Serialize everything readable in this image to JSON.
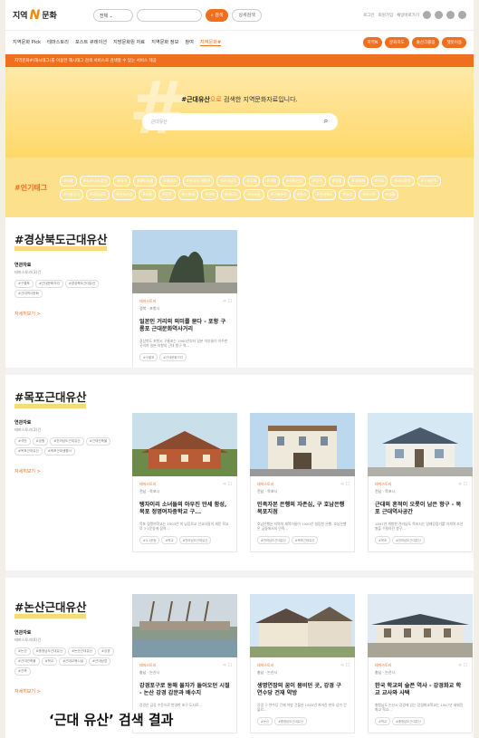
{
  "header": {
    "logo_left": "지역",
    "logo_mark": "N",
    "logo_right": "문화",
    "search_select": "전체",
    "search_button": "검색",
    "detail_search": "상세검색",
    "util_links": [
      "로그인",
      "회원가입",
      "채널바로가기"
    ]
  },
  "gnb": {
    "items": [
      "지역문화 Pick",
      "테마스토리",
      "포스트 큐레이션",
      "지방문화원 자료",
      "지역문화 정보",
      "참여",
      "지역문화#"
    ],
    "active": "지역문화#",
    "right_buttons": [
      "지역N",
      "문화지도",
      "출산크롤링",
      "챗봇이용"
    ]
  },
  "notice": "지역문화#(해시태그)를 이용한 해시태그 검색 서비스로 검색할 수 있는 서비스 제공",
  "hero": {
    "title_pre": "#근대유산",
    "title_post": "으로 검색한 지역문화자료입니다.",
    "search_value": "근대유산",
    "search_icon": "search-icon"
  },
  "popular": {
    "label": "#인기태그",
    "tags": [
      "#지역",
      "#조선시대 풍속",
      "#유학",
      "#향토인물",
      "#해양사",
      "#한국의 재발견",
      "#전라남도",
      "#무형",
      "#기행",
      "#전통산업",
      "#경주",
      "#명절",
      "#대백제",
      "#민요",
      "#세시풍속",
      "#구비문학",
      "#전통음식",
      "#경상남도",
      "#민속신앙",
      "#사찰",
      "#문학",
      "#근현대",
      "#건축",
      "#대나무",
      "#석조물",
      "#근대유산",
      "#향교",
      "#전라북도",
      "#농업",
      "#의식주",
      "#생활"
    ]
  },
  "sections": [
    {
      "title": "#경상북도근대유산",
      "label": "연관자료",
      "sub": "테마스토리(1)건",
      "tags": [
        "#구룡포",
        "#근대문화거리",
        "#경상북도근대유산",
        "#근대역사문화"
      ],
      "more": "자세히보기 >",
      "cards": [
        {
          "cat": "테마스토리",
          "loc": "경북 · 포항시",
          "title": "일본인 거리의 의미를 묻다 - 포항 구룡포 근대문화역사거리",
          "desc": "경상북도 포항시 구룡포는 1900년부터 일본 어부들이 이주한 곳이자 일본 어항의 근대 항구 역...",
          "tags": [
            "#구룡포",
            "#근대문화거리"
          ]
        }
      ]
    },
    {
      "title": "#목포근대유산",
      "label": "연관자료",
      "sub": "테마스토리(3)건",
      "tags": [
        "#석탄",
        "#공원",
        "#전라남도근대유산",
        "#근대건축물",
        "#목포근대유산",
        "#목포근대생활사"
      ],
      "more": "자세히보기 >",
      "cards": [
        {
          "cat": "테마스토리",
          "loc": "전남 · 목포시",
          "title": "탱자이리 소녀들의 아우진 만세 함성, 목포 정명여자중학교 구...",
          "desc": "목포 정명여학교는 1903년 미 남장로교 선교사들이 세운 학교로 3·1운동에 참여...",
          "tags": [
            "#3.1운동",
            "#학교",
            "#전라남도근대유산"
          ]
        },
        {
          "cat": "테마스토리",
          "loc": "전남 · 목포시",
          "title": "민족자본 은행의 자존심, 구 호남은행 목포지점",
          "desc": "호남은행은 지역의 재력가들이 1920년 설립한 은행. 호남은행은 금융에서의 민족...",
          "tags": [
            "#전라남도근대유산",
            "#목포근대유산"
          ]
        },
        {
          "cat": "테마스토리",
          "loc": "전남 · 목포시",
          "title": "근대의 흔적이 오롯이 남은 항구 - 목포 근대역사공간",
          "desc": "1897년 개항한 전라남도 목포시는 일제강점기를 거치며 조선 쌀을 수탈하던 항구...",
          "tags": [
            "#목포",
            "#전라남도근대유산"
          ]
        }
      ]
    },
    {
      "title": "#논산근대유산",
      "label": "연관자료",
      "sub": "테마스토리(4)건",
      "tags": [
        "#논산",
        "#충청남도근대유산",
        "#논산근대유산",
        "#강경",
        "#근대건축물",
        "#학교",
        "#근대교육시설",
        "#근대상업",
        "#건축"
      ],
      "more": "자세히보기 >",
      "cards": [
        {
          "cat": "테마스토리",
          "loc": "충남 · 논산시",
          "title": "강경포구로 동해 물자가 들어오던 시절 - 논산 강경 갑문과 배수지",
          "desc": "강경은 금강 수운으로 번영한 포구 도시로...",
          "tags": [
            "#논산",
            "#충청남도근대유산"
          ]
        },
        {
          "cat": "테마스토리",
          "loc": "충남 · 논산시",
          "title": "생명연장의 꿈이 뭄비던 곳, 강경 구 연수당 건재 약방",
          "desc": "강경 구 연수당 건재 약방 건물은 1920년 지어진 한옥 상가 건물로...",
          "tags": [
            "#논산",
            "#충청남도근대유산"
          ]
        },
        {
          "cat": "테마스토리",
          "loc": "충남 · 논산시",
          "title": "한국 학교의 슬픈 역사 - 강경화교 학교 교사와 사택",
          "desc": "충청남도 논산시 강경에 있는 강경화교학교는 1947년 세워진 화교 학교...",
          "tags": [
            "#학교",
            "#충청남도근대유산"
          ]
        }
      ]
    }
  ],
  "caption": "‘근대 유산’ 검색 결과",
  "colors": {
    "accent": "#f06f1f",
    "hero": "#ffd86a",
    "tags_bg": "#fde08c"
  }
}
